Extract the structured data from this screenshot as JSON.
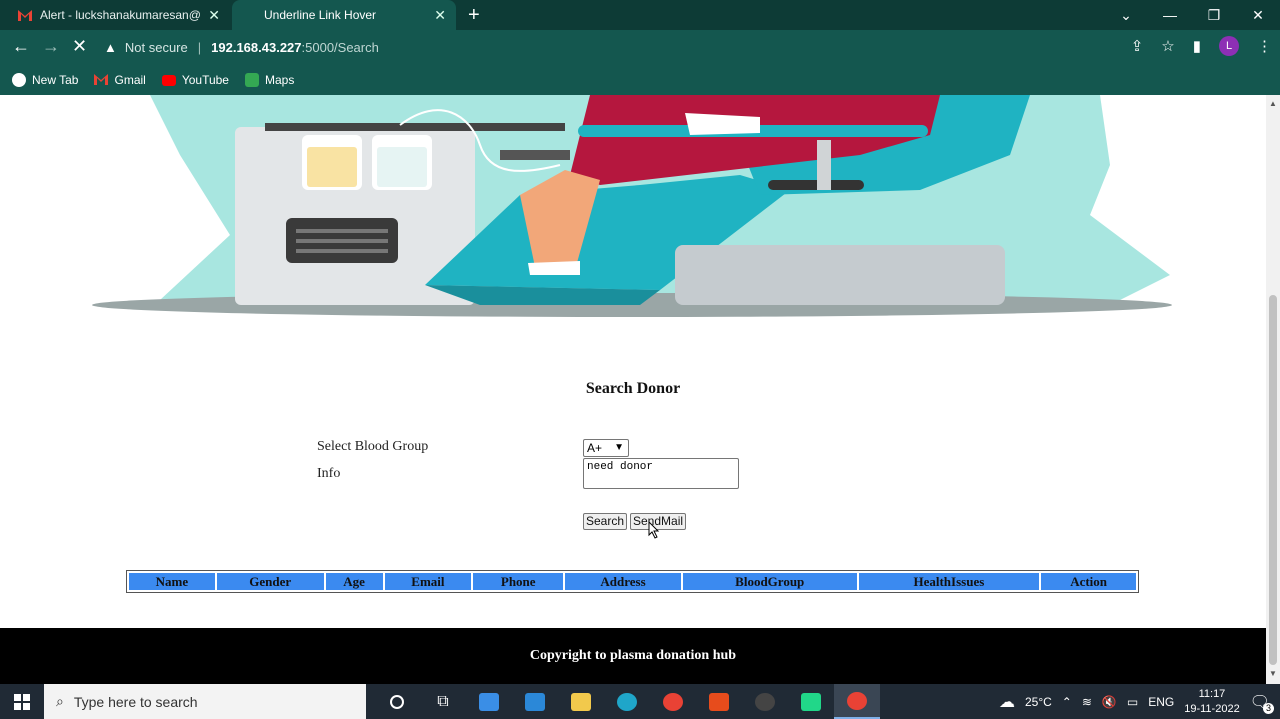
{
  "browser": {
    "tabs": [
      {
        "title": "Alert - luckshanakumaresan@gm",
        "active": false
      },
      {
        "title": "Underline Link Hover",
        "active": true
      }
    ],
    "url": {
      "security": "Not secure",
      "host": "192.168.43.227",
      "path": ":5000/Search"
    },
    "profile_initial": "L",
    "bookmarks": [
      "New Tab",
      "Gmail",
      "YouTube",
      "Maps"
    ]
  },
  "page": {
    "title": "Search Donor",
    "form": {
      "blood_group_label": "Select Blood Group",
      "blood_group_value": "A+",
      "info_label": "Info",
      "info_value": "need donor",
      "search_button": "Search",
      "sendmail_button": "SendMail"
    },
    "table_headers": [
      "Name",
      "Gender",
      "Age",
      "Email",
      "Phone",
      "Address",
      "BloodGroup",
      "HealthIssues",
      "Action"
    ],
    "footer": "Copyright to plasma donation hub"
  },
  "taskbar": {
    "search_placeholder": "Type here to search",
    "weather": "25°C",
    "language": "ENG",
    "time": "11:17",
    "date": "19-11-2022",
    "notification_count": "3"
  },
  "colors": {
    "chrome_dark": "#0d3b36",
    "chrome": "#14574f",
    "table_header": "#3b8af0",
    "footer": "#000000"
  }
}
